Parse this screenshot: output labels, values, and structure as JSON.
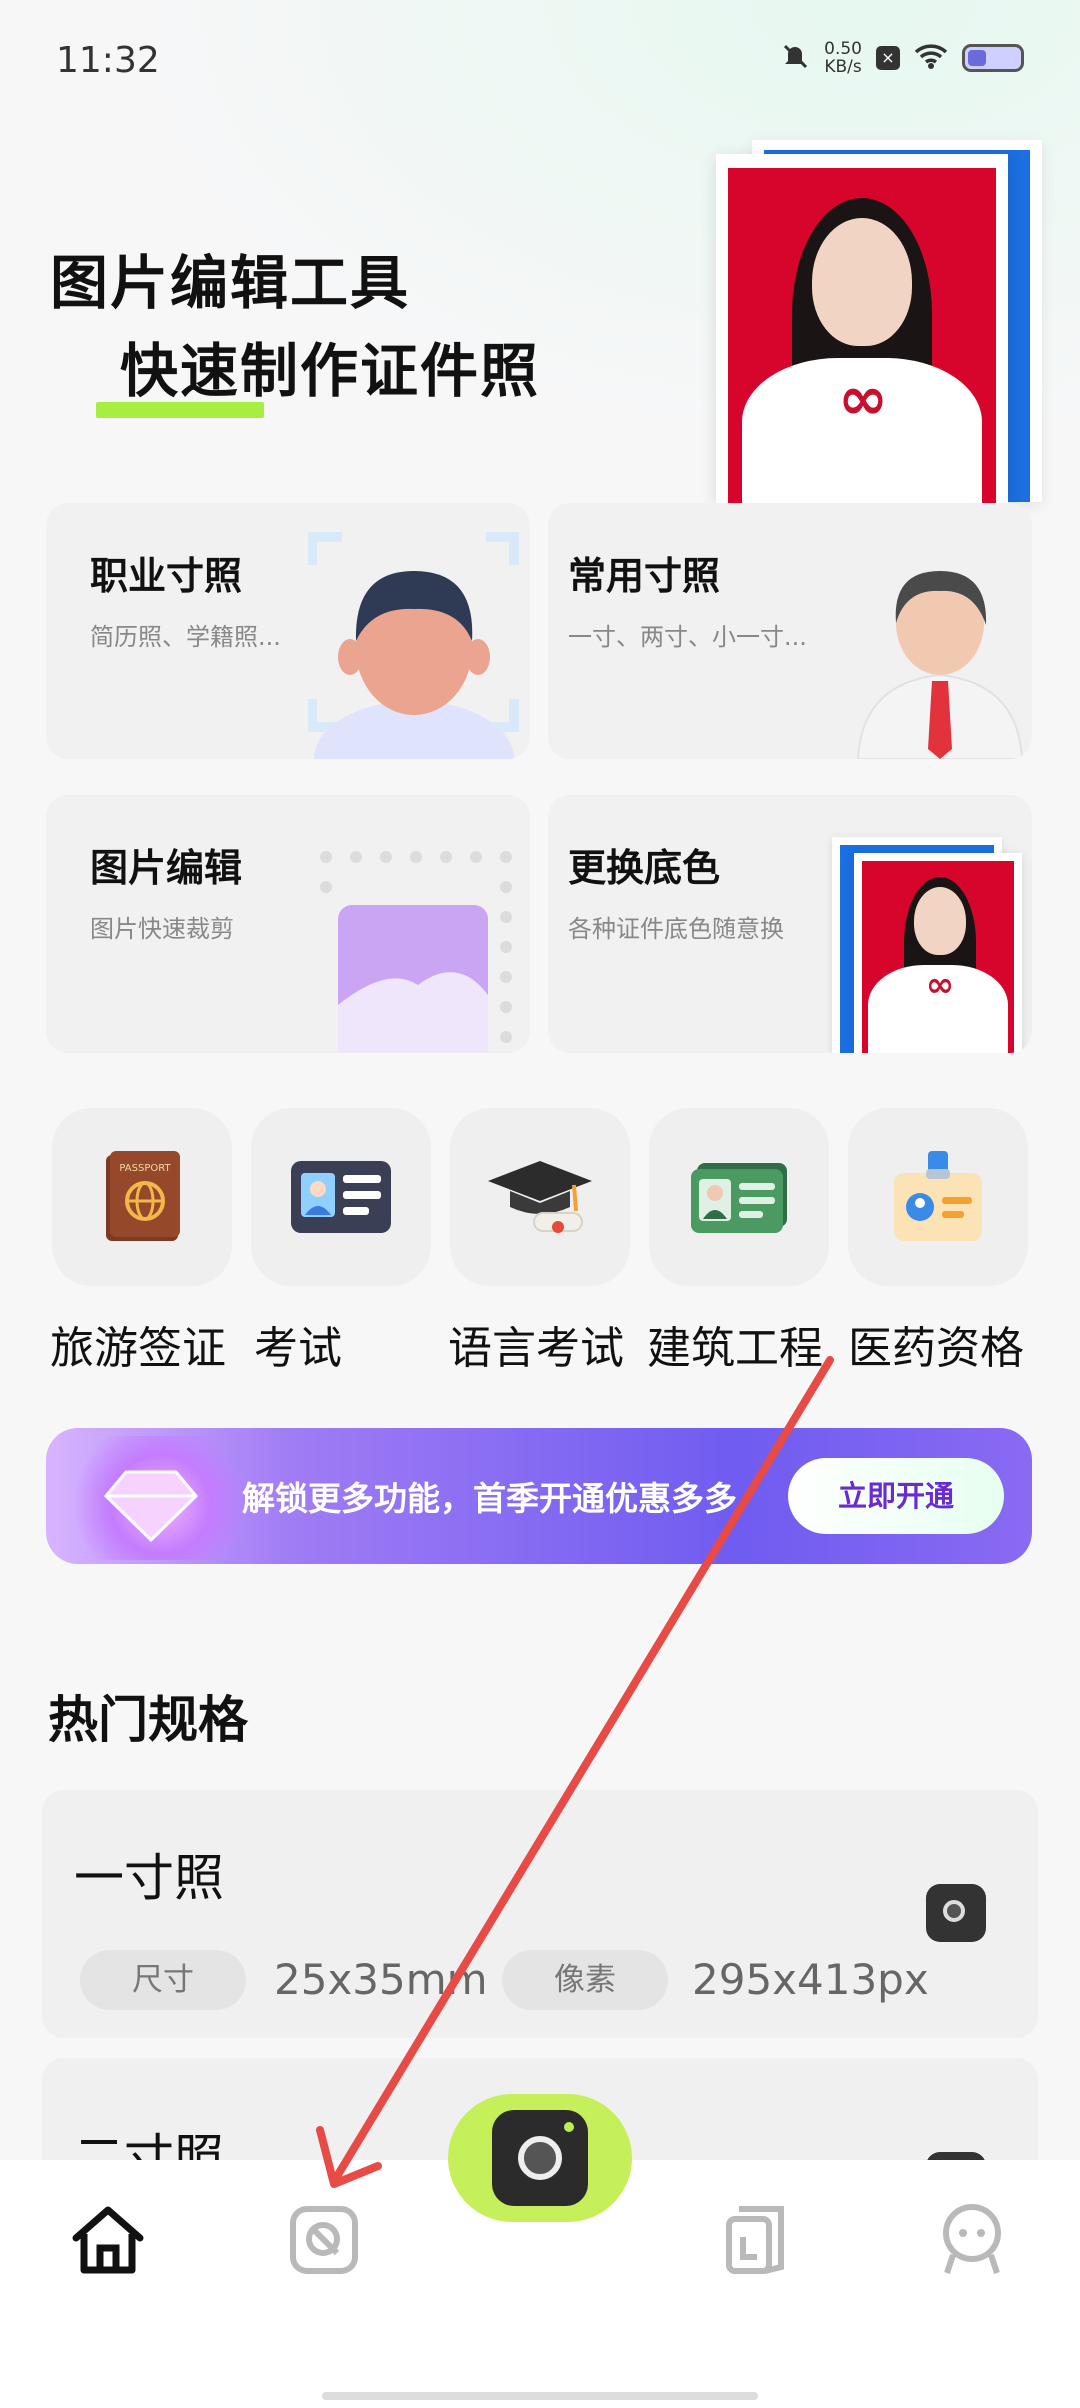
{
  "status_bar": {
    "time": "11:32",
    "net_speed": "0.50",
    "net_unit": "KB/s"
  },
  "hero": {
    "line1": "图片编辑工具",
    "line2": "快速制作证件照"
  },
  "cards": [
    {
      "title": "职业寸照",
      "subtitle": "简历照、学籍照..."
    },
    {
      "title": "常用寸照",
      "subtitle": "一寸、两寸、小一寸..."
    },
    {
      "title": "图片编辑",
      "subtitle": "图片快速裁剪"
    },
    {
      "title": "更换底色",
      "subtitle": "各种证件底色随意换"
    }
  ],
  "categories": [
    {
      "label": "旅游签证",
      "icon": "passport-icon"
    },
    {
      "label": "考试",
      "icon": "id-card-icon"
    },
    {
      "label": "语言考试",
      "icon": "graduation-cap-icon"
    },
    {
      "label": "建筑工程",
      "icon": "certificate-card-icon"
    },
    {
      "label": "医药资格",
      "icon": "badge-icon"
    }
  ],
  "promo": {
    "text": "解锁更多功能，首季开通优惠多多",
    "button": "立即开通"
  },
  "section": {
    "title": "热门规格"
  },
  "specs": [
    {
      "name": "一寸照",
      "size_label": "尺寸",
      "size": "25x35mm",
      "pixel_label": "像素",
      "pixels": "295x413px"
    },
    {
      "name": "二寸照"
    }
  ],
  "nav": {
    "items": [
      "home-icon",
      "tools-icon",
      "camera-icon",
      "document-icon",
      "profile-icon"
    ]
  },
  "colors": {
    "accent_green": "#a6ef42",
    "photo_red": "#d7052b",
    "photo_blue": "#1b6fe0",
    "arrow_red": "#e84a45"
  }
}
